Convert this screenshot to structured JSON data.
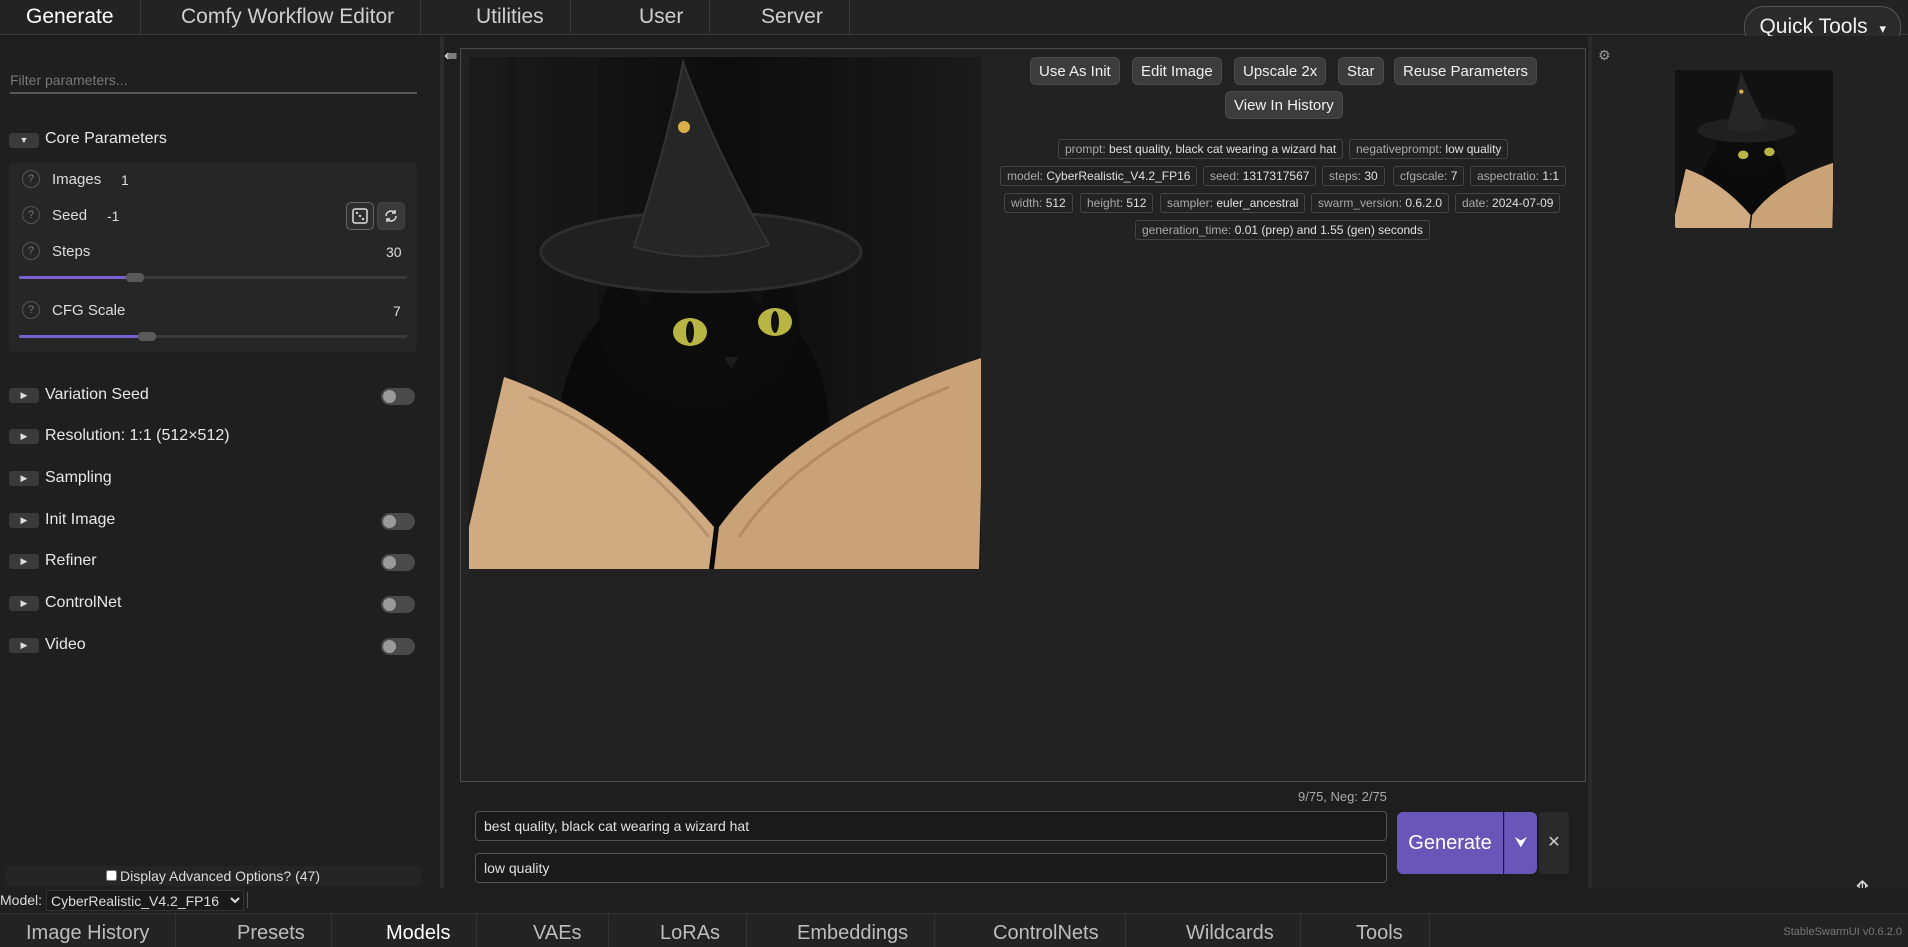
{
  "top_tabs": [
    "Generate",
    "Comfy Workflow Editor",
    "Utilities",
    "User",
    "Server"
  ],
  "quick_tools": {
    "label": "Quick Tools",
    "caret": "▾"
  },
  "left": {
    "filter_placeholder": "Filter parameters...",
    "core_group": {
      "label": "Core Parameters",
      "toggle_icon": "▼"
    },
    "params": {
      "images": {
        "label": "Images",
        "value": "1"
      },
      "seed": {
        "label": "Seed",
        "value": "-1"
      },
      "steps": {
        "label": "Steps",
        "value": "30",
        "slider_level": 0.3
      },
      "cfg": {
        "label": "CFG Scale",
        "value": "7",
        "slider_level": 0.33
      }
    },
    "help_glyph": "?",
    "groups": [
      {
        "label": "Variation Seed",
        "toggle": true
      },
      {
        "label": "Resolution: 1:1 (512×512)",
        "toggle": false
      },
      {
        "label": "Sampling",
        "toggle": false
      },
      {
        "label": "Init Image",
        "toggle": true
      },
      {
        "label": "Refiner",
        "toggle": true
      },
      {
        "label": "ControlNet",
        "toggle": true
      },
      {
        "label": "Video",
        "toggle": true
      }
    ],
    "expand_icon": "▶",
    "advanced_options": "Display Advanced Options? (47)"
  },
  "actions": {
    "use_as_init": "Use As Init",
    "edit_image": "Edit Image",
    "upscale": "Upscale 2x",
    "star": "Star",
    "reuse": "Reuse Parameters",
    "history": "View In History"
  },
  "metadata": {
    "prompt": {
      "k": "prompt:",
      "v": "best quality, black cat wearing a wizard hat"
    },
    "negativeprompt": {
      "k": "negativeprompt:",
      "v": "low quality"
    },
    "model": {
      "k": "model:",
      "v": "CyberRealistic_V4.2_FP16"
    },
    "seed": {
      "k": "seed:",
      "v": "1317317567"
    },
    "steps": {
      "k": "steps:",
      "v": "30"
    },
    "cfgscale": {
      "k": "cfgscale:",
      "v": "7"
    },
    "aspectratio": {
      "k": "aspectratio:",
      "v": "1:1"
    },
    "width": {
      "k": "width:",
      "v": "512"
    },
    "height": {
      "k": "height:",
      "v": "512"
    },
    "sampler": {
      "k": "sampler:",
      "v": "euler_ancestral"
    },
    "swarm_version": {
      "k": "swarm_version:",
      "v": "0.6.2.0"
    },
    "date": {
      "k": "date:",
      "v": "2024-07-09"
    },
    "generation_time": {
      "k": "generation_time:",
      "v": "0.01 (prep) and 1.55 (gen) seconds"
    }
  },
  "prompt_area": {
    "token_count": "9/75, Neg: 2/75",
    "prompt": "best quality, black cat wearing a wizard hat",
    "negative_prompt": "low quality",
    "generate_label": "Generate",
    "generate_dropdown_icon": "⮟",
    "cancel_icon": "✕"
  },
  "model_bar": {
    "label": "Model:",
    "selected": "CyberRealistic_V4.2_FP16"
  },
  "bottom_tabs": [
    "Image History",
    "Presets",
    "Models",
    "VAEs",
    "LoRAs",
    "Embeddings",
    "ControlNets",
    "Wildcards",
    "Tools"
  ],
  "version": "StableSwarmUI v0.6.2.0",
  "icons": {
    "collapse": "⇚",
    "gear": "⚙",
    "scroll_top": "⤊"
  },
  "colors": {
    "accent": "#6a55b8",
    "slider": "#7a5fd0"
  }
}
